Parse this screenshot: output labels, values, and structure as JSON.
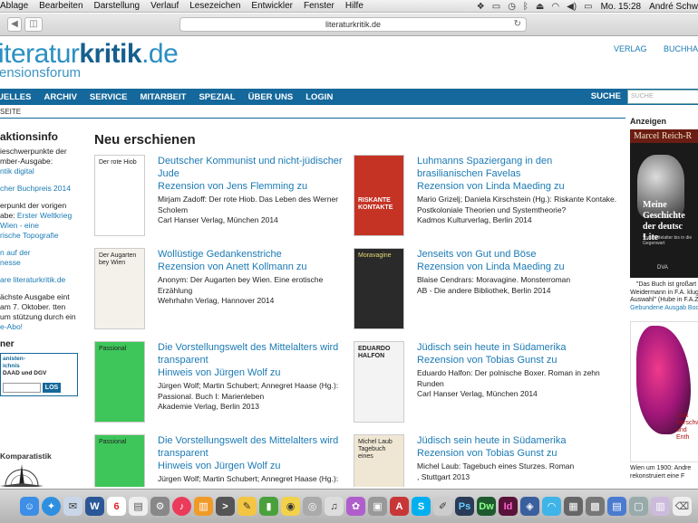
{
  "menubar": {
    "items": [
      "Ablage",
      "Bearbeiten",
      "Darstellung",
      "Verlauf",
      "Lesezeichen",
      "Entwickler",
      "Fenster",
      "Hilfe"
    ],
    "clock": "Mo. 15:28",
    "user": "André Schw"
  },
  "browser": {
    "url": "literaturkritik.de"
  },
  "site": {
    "logo_part1": "iteratur",
    "logo_part2": "kritik",
    "logo_part3": ".de",
    "subtitle": "ensionsforum",
    "toplinks": [
      "VERLAG",
      "BUCHHA"
    ]
  },
  "nav": {
    "items": [
      "UELLES",
      "ARCHIV",
      "SERVICE",
      "MITARBEIT",
      "SPEZIAL",
      "ÜBER UNS",
      "LOGIN"
    ],
    "search_label": "SUCHE",
    "search_placeholder": "SUCHE"
  },
  "breadcrumb": "SEITE",
  "left_sidebar": {
    "heading": "aktionsinfo",
    "p1_text": "ieschwerpunkte der mber-Ausgabe:",
    "p1_link": "ntik digital",
    "p2_link": "cher Buchpreis 2014",
    "p3_text": "erpunkt der vorigen abe:",
    "p3_link1": "Erster Weltkrieg",
    "p3_link2": "Wien - eine",
    "p3_link3": "rische Topografie",
    "p4_link1": "n auf der",
    "p4_link2": "nesse",
    "p5_link": "are literaturkritik.de",
    "p6_text": "ächste Ausgabe eint am 7. Oktober. tten um stützung durch ein",
    "p6_link": "e-Abo!",
    "h_partner": "ner",
    "block_line1": "anisten-",
    "block_line2": "ichnis",
    "block_line3": "DAAD und DGV",
    "block_btn": "LOS",
    "komp_label": "Komparatistik"
  },
  "main": {
    "heading": "Neu erschienen",
    "items": [
      {
        "title": "Deutscher Kommunist und nicht-jüdischer Jude",
        "review": "Rezension von Jens Flemming zu",
        "meta1": "Mirjam Zadoff: Der rote Hiob. Das Leben des Werner Scholem",
        "meta2": "Carl Hanser Verlag, München 2014",
        "cover_text": "Der rote Hiob"
      },
      {
        "title": "Luhmanns Spaziergang in den brasilianischen Favelas",
        "review": "Rezension von Linda Maeding zu",
        "meta1": "Mario Grizelj; Daniela Kirschstein (Hg.): Riskante Kontake. Postkoloniale Theorien und Systemtheorie?",
        "meta2": "Kadmos Kulturverlag, Berlin 2014",
        "cover_text": "RISKANTE KONTAKTE"
      },
      {
        "title": "Wollüstige Gedankenstriche",
        "review": "Rezension von Anett Kollmann zu",
        "meta1": "Anonym: Der Augarten bey Wien. Eine erotische Erzählung",
        "meta2": "Wehrhahn Verlag, Hannover 2014",
        "cover_text": "Der Augarten bey Wien"
      },
      {
        "title": "Jenseits von Gut und Böse",
        "review": "Rezension von Linda Maeding zu",
        "meta1": "Blaise Cendrars: Moravagine. Monsterroman",
        "meta2": "AB - Die andere Bibliothek, Berlin 2014",
        "cover_text": "Moravagine"
      },
      {
        "title": "Die Vorstellungswelt des Mittelalters wird transparent",
        "review": "Hinweis von Jürgen Wolf zu",
        "meta1": "Jürgen Wolf; Martin Schubert; Annegret Haase (Hg.): Passional. Buch I: Marienleben",
        "meta2": "Akademie Verlag, Berlin 2013",
        "cover_text": "Passional"
      },
      {
        "title": "Jüdisch sein heute in Südamerika",
        "review": "Rezension von Tobias Gunst zu",
        "meta1": "Eduardo Halfon: Der polnische Boxer. Roman in zehn Runden",
        "meta2": "Carl Hanser Verlag, München 2014",
        "cover_text": "EDUARDO HALFON"
      },
      {
        "title": "Die Vorstellungswelt des Mittelalters wird transparent",
        "review": "Hinweis von Jürgen Wolf zu",
        "meta1": "Jürgen Wolf; Martin Schubert; Annegret Haase (Hg.): Passional. Buch II: Apostellegenden",
        "meta2": "",
        "cover_text": "Passional"
      },
      {
        "title": "Jüdisch sein heute in Südamerika",
        "review": "Rezension von Tobias Gunst zu",
        "meta1": "Michel Laub: Tagebuch eines Sturzes. Roman",
        "meta2": ", Stuttgart 2013",
        "cover_text": "Michel Laub Tagebuch eines"
      }
    ]
  },
  "right_sidebar": {
    "heading": "Anzeigen",
    "ad1_header": "Marcel Reich-R",
    "ad1_big": "Meine Geschichte der deutsc Lite",
    "ad1_small": "Vom Mittelalter bis in die Gegenwart",
    "ad1_dva": "DVA",
    "ad1_caption": "\"Das Buch ist großart Weidermann in F.A. kluge Auswahl\" (Hube in F.A.Z.)",
    "ad1_link": "Gebundene Ausgab Book",
    "ad2_text": "Lust Verschw und Enth",
    "ad2_caption": "Wien um 1900: Andre rekonstruiert eine F"
  }
}
